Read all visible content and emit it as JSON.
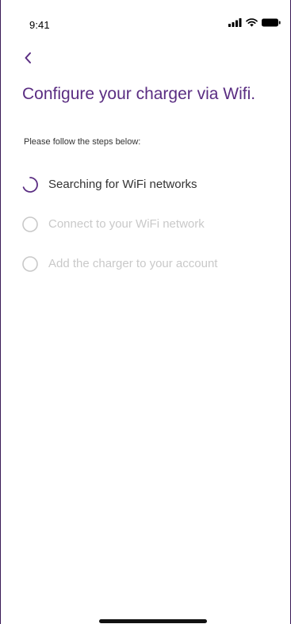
{
  "status_bar": {
    "time": "9:41"
  },
  "header": {
    "back_icon": "chevron-left-icon",
    "title": "Configure your charger via Wifi.",
    "subtitle": "Please follow the steps below:"
  },
  "steps": [
    {
      "label": "Searching for WiFi networks",
      "state": "in-progress",
      "icon": "spinner-icon"
    },
    {
      "label": "Connect to your WiFi network",
      "state": "pending",
      "icon": "circle-icon"
    },
    {
      "label": "Add the charger to your account",
      "state": "pending",
      "icon": "circle-icon"
    }
  ],
  "colors": {
    "accent": "#5a2d82",
    "text": "#333333",
    "disabled": "#c9c9c9",
    "frame": "#3a1a57"
  }
}
